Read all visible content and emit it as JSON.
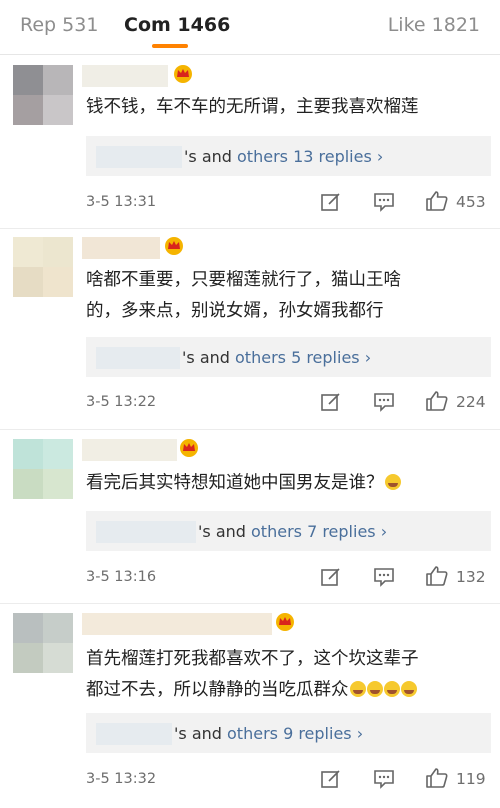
{
  "tabs": {
    "repost": "Rep 531",
    "comments": "Com 1466",
    "likes": "Like 1821"
  },
  "colors": {
    "accent": "#ff8200",
    "link": "#4a6f9b"
  },
  "comments": [
    {
      "lines": [
        "钱不钱，车不车的无所谓，主要我喜欢榴莲"
      ],
      "replies_prefix": "'s and ",
      "replies_link": "others 13 replies",
      "time": "3-5 13:31",
      "likes": "453"
    },
    {
      "lines": [
        "啥都不重要，只要榴莲就行了，猫山王啥",
        "的，多来点，别说女婿，孙女婿我都行"
      ],
      "replies_prefix": "'s and ",
      "replies_link": "others 5 replies",
      "time": "3-5 13:22",
      "likes": "224"
    },
    {
      "lines": [
        "看完后其实特想知道她中国男友是谁？"
      ],
      "replies_prefix": "'s and ",
      "replies_link": "others 7 replies",
      "time": "3-5 13:16",
      "likes": "132"
    },
    {
      "lines": [
        "首先榴莲打死我都喜欢不了，这个坎这辈子",
        "都过不去，所以静静的当吃瓜群众"
      ],
      "replies_prefix": "'s and ",
      "replies_link": "others 9 replies",
      "time": "3-5 13:32",
      "likes": "119"
    }
  ],
  "icons": {
    "edit": "edit-icon",
    "comment": "comment-icon",
    "like": "thumbs-up-icon",
    "chevron": "chevron-right-icon",
    "crown": "crown-badge-icon",
    "emoji": "laughing-emoji-icon"
  }
}
